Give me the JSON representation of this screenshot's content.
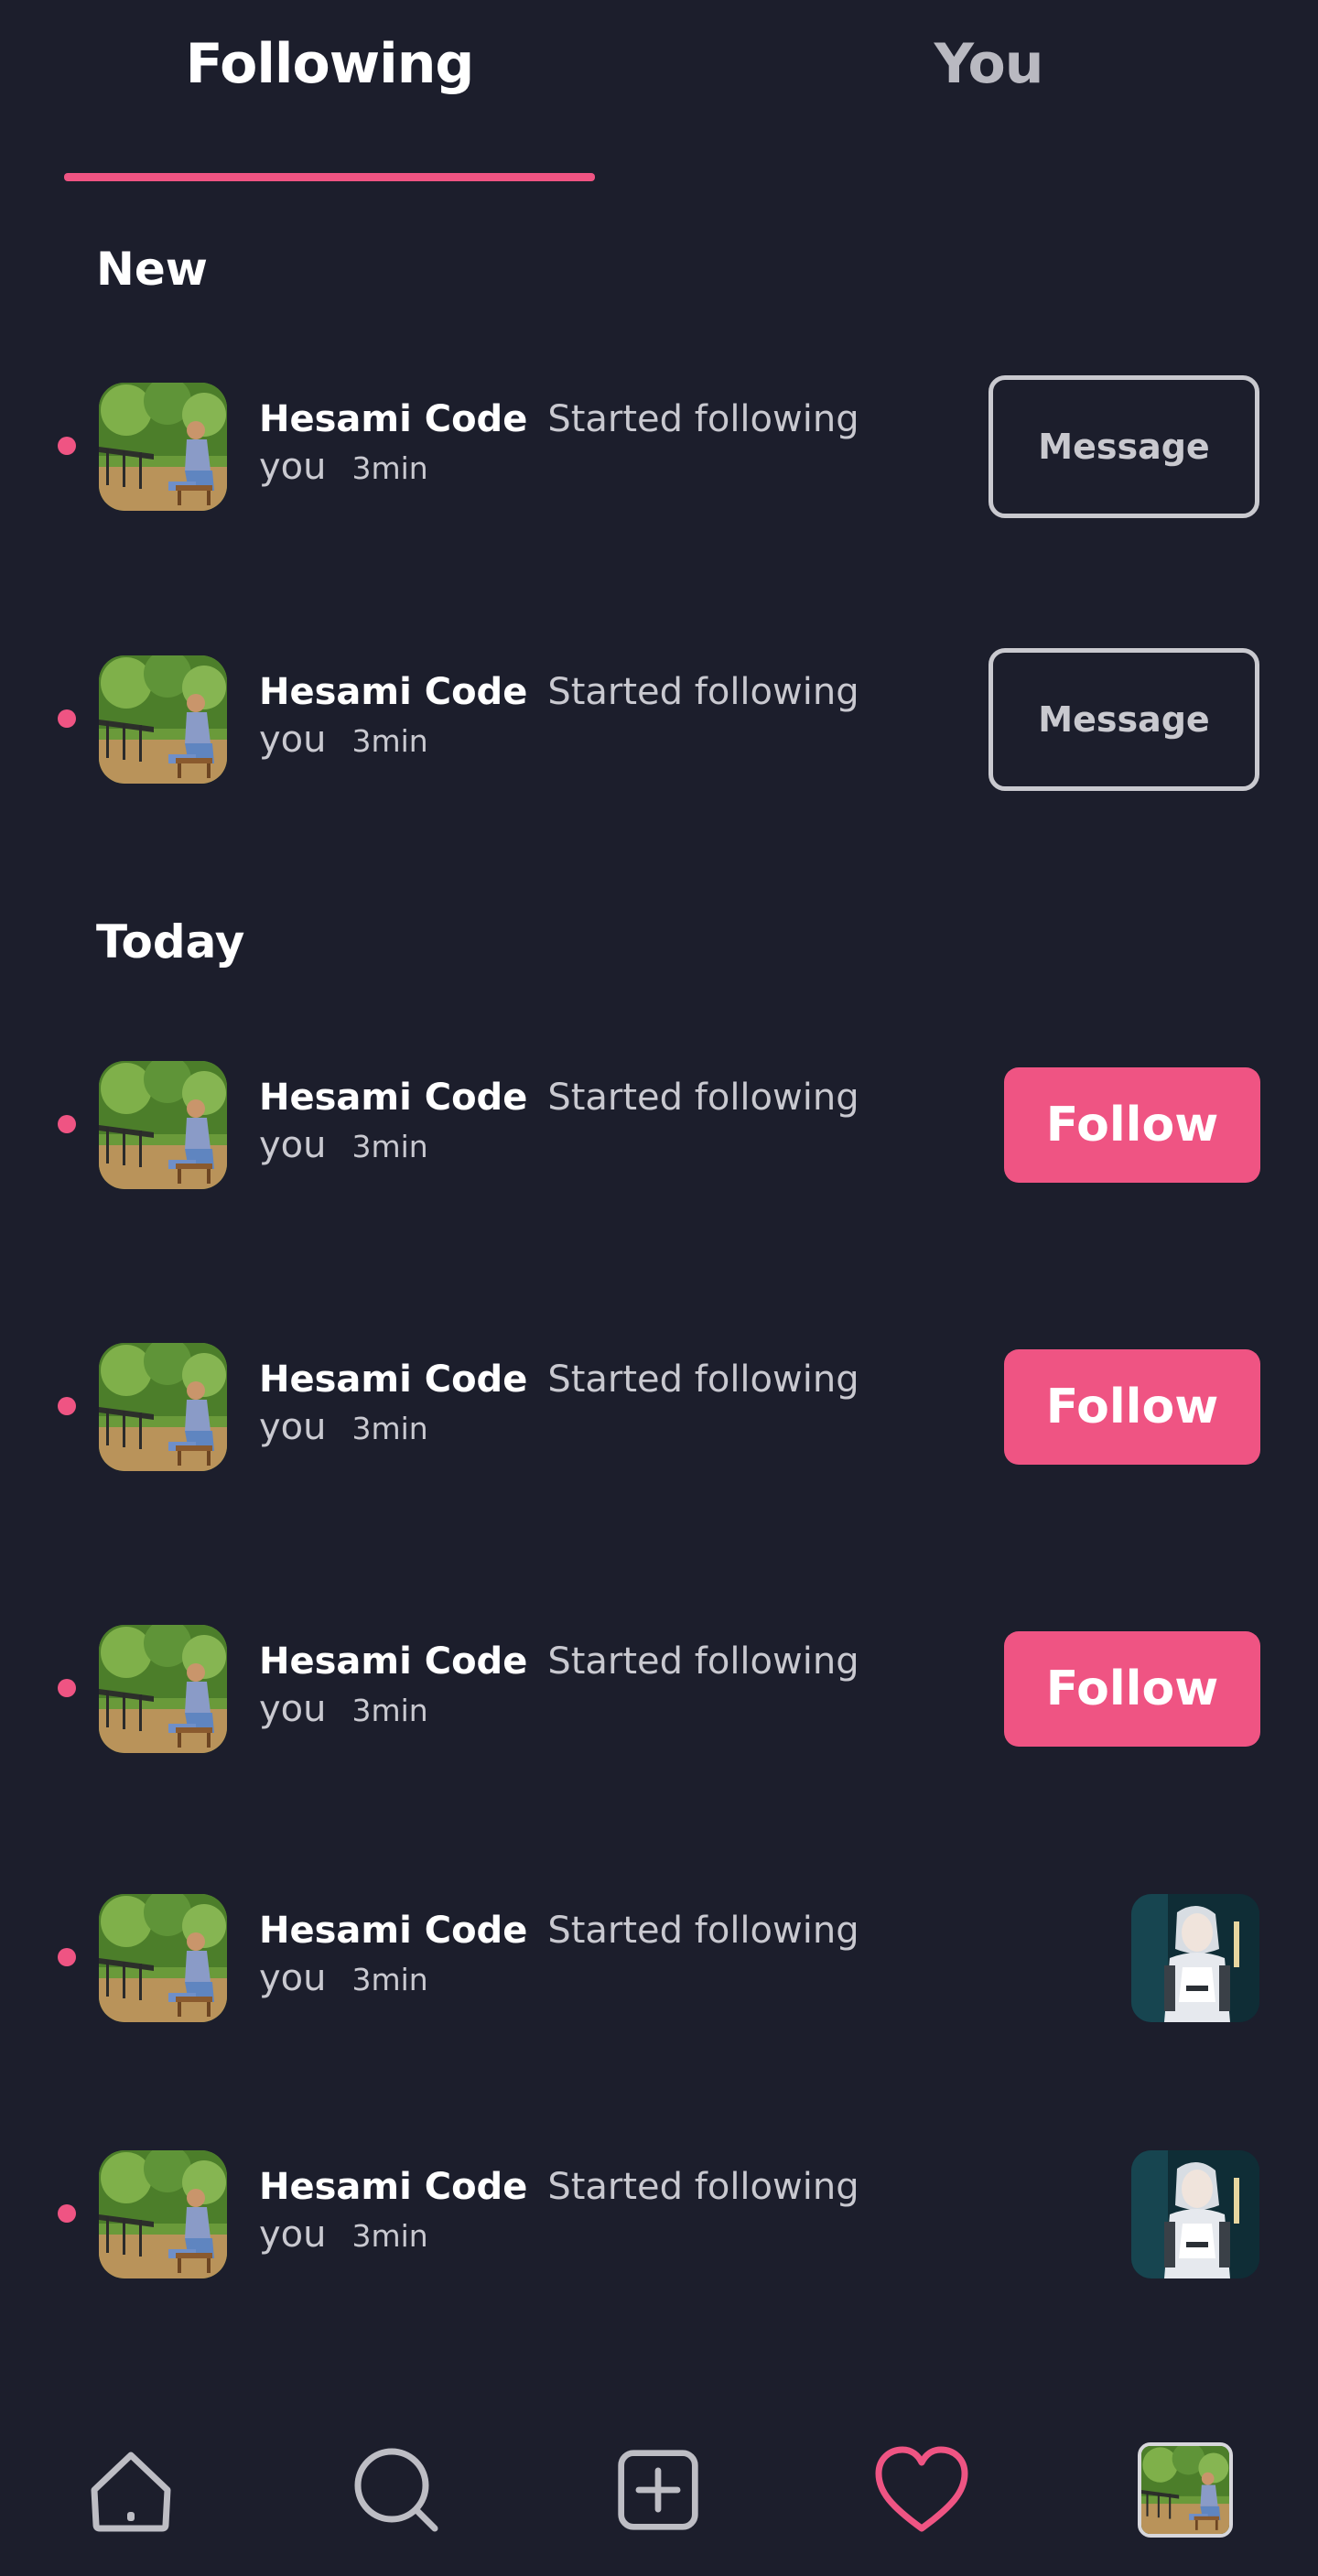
{
  "tabs": [
    {
      "label": "Following",
      "active": true
    },
    {
      "label": "You",
      "active": false
    }
  ],
  "sections": {
    "new_title": "New",
    "today_title": "Today"
  },
  "notifications": [
    {
      "section": "New",
      "name": "Hesami Code",
      "action": "Started following",
      "object": "you",
      "time": "3min",
      "button": "Message",
      "unread": true
    },
    {
      "section": "New",
      "name": "Hesami Code",
      "action": "Started following",
      "object": "you",
      "time": "3min",
      "button": "Message",
      "unread": true
    },
    {
      "section": "Today",
      "name": "Hesami Code",
      "action": "Started following",
      "object": "you",
      "time": "3min",
      "button": "Follow",
      "unread": true
    },
    {
      "section": "Today",
      "name": "Hesami Code",
      "action": "Started following",
      "object": "you",
      "time": "3min",
      "button": "Follow",
      "unread": true
    },
    {
      "section": "Today",
      "name": "Hesami Code",
      "action": "Started following",
      "object": "you",
      "time": "3min",
      "button": "Follow",
      "unread": true
    },
    {
      "section": "Today",
      "name": "Hesami Code",
      "action": "Started following",
      "object": "you",
      "time": "3min",
      "thumbnail": "post-thumbnail",
      "unread": true
    },
    {
      "section": "Today",
      "name": "Hesami Code",
      "action": "Started following",
      "object": "you",
      "time": "3min",
      "thumbnail": "post-thumbnail",
      "unread": true
    }
  ],
  "bottom_nav": [
    {
      "icon": "home-icon",
      "active": false
    },
    {
      "icon": "search-icon",
      "active": false
    },
    {
      "icon": "add-post-icon",
      "active": false
    },
    {
      "icon": "heart-icon",
      "active": true
    },
    {
      "icon": "profile-avatar",
      "active": false
    }
  ],
  "colors": {
    "background": "#1c1e2c",
    "accent": "#ef5483",
    "text_primary": "#ffffff",
    "text_secondary": "#c9c9d0",
    "button_outline": "#c9c9cf"
  }
}
